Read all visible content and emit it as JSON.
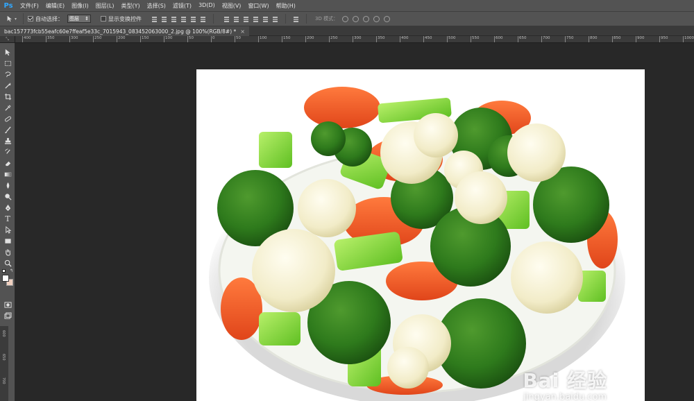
{
  "app": {
    "logo": "Ps"
  },
  "menu": [
    "文件(F)",
    "编辑(E)",
    "图像(I)",
    "图层(L)",
    "类型(Y)",
    "选择(S)",
    "滤镜(T)",
    "3D(D)",
    "视图(V)",
    "窗口(W)",
    "帮助(H)"
  ],
  "options": {
    "auto_select_label": "自动选择：",
    "auto_select_checked": true,
    "auto_select_value": "图层",
    "show_transform_label": "显示变换控件",
    "show_transform_checked": false,
    "mode_3d_label": "3D 模式："
  },
  "document_tab": {
    "title": "bac157773fcb55eafc60e7ffeaf5e33c_7015943_083452063000_2.jpg @ 100%(RGB/8#) *",
    "close": "×"
  },
  "ruler_ticks": [
    "400",
    "350",
    "300",
    "250",
    "200",
    "150",
    "100",
    "50",
    "0",
    "50",
    "100",
    "150",
    "200",
    "250",
    "300",
    "350",
    "400",
    "450",
    "500",
    "550",
    "600",
    "650",
    "700",
    "750",
    "800",
    "850",
    "900",
    "950",
    "1000"
  ],
  "vertical_ruler_ticks": [
    "600",
    "650",
    "700"
  ],
  "watermark": {
    "brand": "Bai 经验",
    "url": "jingyan.baidu.com"
  },
  "colors": {
    "ps_blue": "#31a8ff",
    "panel": "#535353",
    "workspace": "#282828"
  }
}
